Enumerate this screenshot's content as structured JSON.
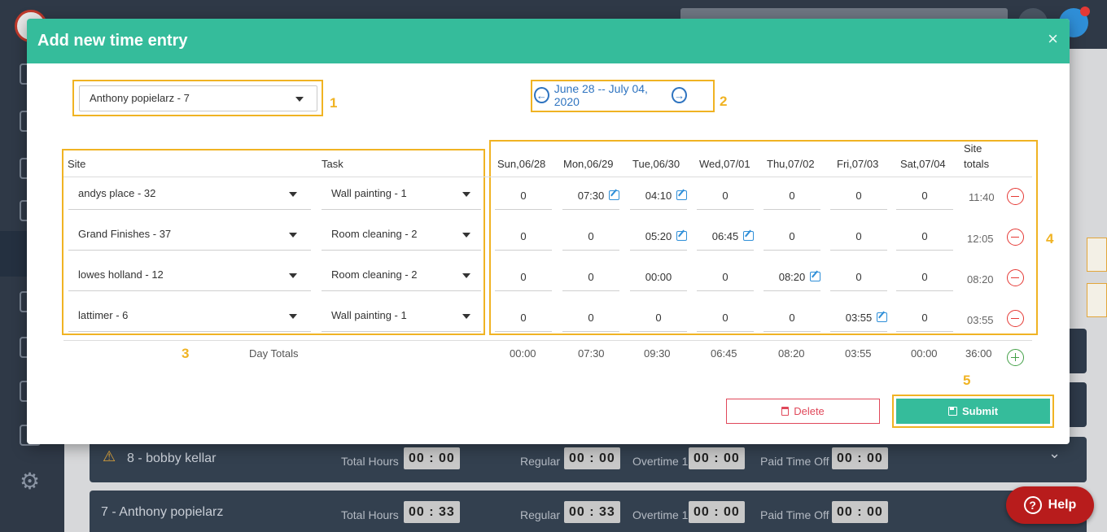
{
  "background": {
    "rows": [
      {
        "name": "8 - bobby kellar",
        "warning": true,
        "total_hours_label": "Total Hours",
        "total_hours": "00 : 00",
        "regular_label": "Regular",
        "regular": "00 : 00",
        "overtime_label": "Overtime 1",
        "overtime": "00 : 00",
        "pto_label": "Paid Time Off",
        "pto": "00 : 00"
      },
      {
        "name": "7 - Anthony popielarz",
        "warning": false,
        "total_hours_label": "Total Hours",
        "total_hours": "00 : 33",
        "regular_label": "Regular",
        "regular": "00 : 33",
        "overtime_label": "Overtime 1",
        "overtime": "00 : 00",
        "pto_label": "Paid Time Off",
        "pto": "00 : 00"
      }
    ],
    "help_label": "Help"
  },
  "modal": {
    "title": "Add new time entry",
    "close_symbol": "×",
    "employee_select": "Anthony popielarz - 7",
    "week_label": "June 28 -- July 04, 2020",
    "columns": {
      "site": "Site",
      "task": "Task",
      "days": [
        "Sun,06/28",
        "Mon,06/29",
        "Tue,06/30",
        "Wed,07/01",
        "Thu,07/02",
        "Fri,07/03",
        "Sat,07/04"
      ],
      "site_totals_1": "Site",
      "site_totals_2": "totals"
    },
    "entries": [
      {
        "site": "andys place - 32",
        "task": "Wall painting - 1",
        "times": [
          "0",
          "07:30",
          "04:10",
          "0",
          "0",
          "0",
          "0"
        ],
        "edited": [
          false,
          true,
          true,
          false,
          false,
          false,
          false
        ],
        "total": "11:40"
      },
      {
        "site": "Grand Finishes - 37",
        "task": "Room cleaning - 2",
        "times": [
          "0",
          "0",
          "05:20",
          "06:45",
          "0",
          "0",
          "0"
        ],
        "edited": [
          false,
          false,
          true,
          true,
          false,
          false,
          false
        ],
        "total": "12:05"
      },
      {
        "site": "lowes holland - 12",
        "task": "Room cleaning - 2",
        "times": [
          "0",
          "0",
          "00:00",
          "0",
          "08:20",
          "0",
          "0"
        ],
        "edited": [
          false,
          false,
          false,
          false,
          true,
          false,
          false
        ],
        "total": "08:20"
      },
      {
        "site": "lattimer - 6",
        "task": "Wall painting - 1",
        "times": [
          "0",
          "0",
          "0",
          "0",
          "0",
          "03:55",
          "0"
        ],
        "edited": [
          false,
          false,
          false,
          false,
          false,
          true,
          false
        ],
        "total": "03:55"
      }
    ],
    "day_totals_label": "Day Totals",
    "day_totals": [
      "00:00",
      "07:30",
      "09:30",
      "06:45",
      "08:20",
      "03:55",
      "00:00"
    ],
    "grand_total": "36:00",
    "delete_label": "Delete",
    "submit_label": "Submit"
  },
  "annotations": [
    "1",
    "2",
    "3",
    "4",
    "5"
  ],
  "colors": {
    "header": "#35bc9b",
    "annotation": "#f0b323",
    "link": "#2f74c0",
    "danger": "#e53935",
    "success": "#43a047"
  }
}
